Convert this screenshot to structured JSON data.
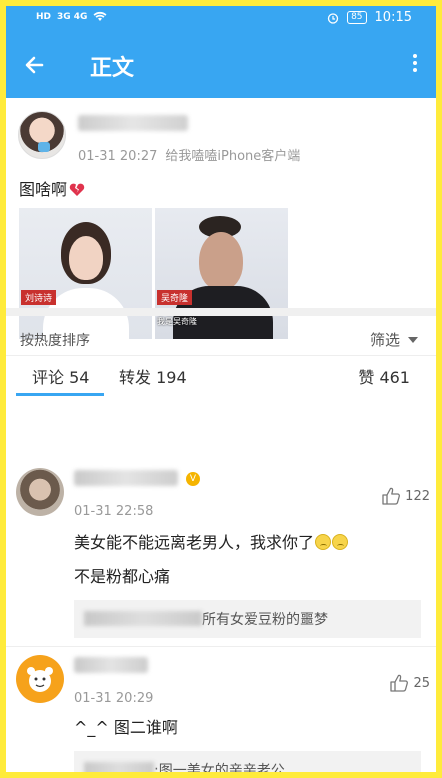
{
  "statusbar": {
    "network_left": "HD",
    "network_sig": "3G 4G",
    "battery": "85",
    "time": "10:15"
  },
  "appbar": {
    "title": "正文"
  },
  "post": {
    "time": "01-31 20:27",
    "source": "给我嗑嗑iPhone客户端",
    "text": "图啥啊",
    "image1_caption": "刘诗诗",
    "image2_caption": "吴奇隆",
    "image2_subtitle": "我是吴奇隆"
  },
  "tabs": {
    "comments": "评论 54",
    "reposts": "转发 194",
    "likes": "赞 461"
  },
  "sort": {
    "label": "按热度排序",
    "filter": "筛选"
  },
  "comments": [
    {
      "time": "01-31 22:58",
      "likes": "122",
      "line1": "美女能不能远离老男人，我求你了",
      "line2": "不是粉都心痛",
      "reply_tail": "所有女爱豆粉的噩梦"
    },
    {
      "time": "01-31 20:29",
      "likes": "25",
      "line1": "^_^ 图二谁啊",
      "reply_tail": ":图一美女的亲亲老公"
    }
  ],
  "colors": {
    "accent": "#38a6f2",
    "frame": "#ffeb3b",
    "verified": "#f5b400"
  }
}
